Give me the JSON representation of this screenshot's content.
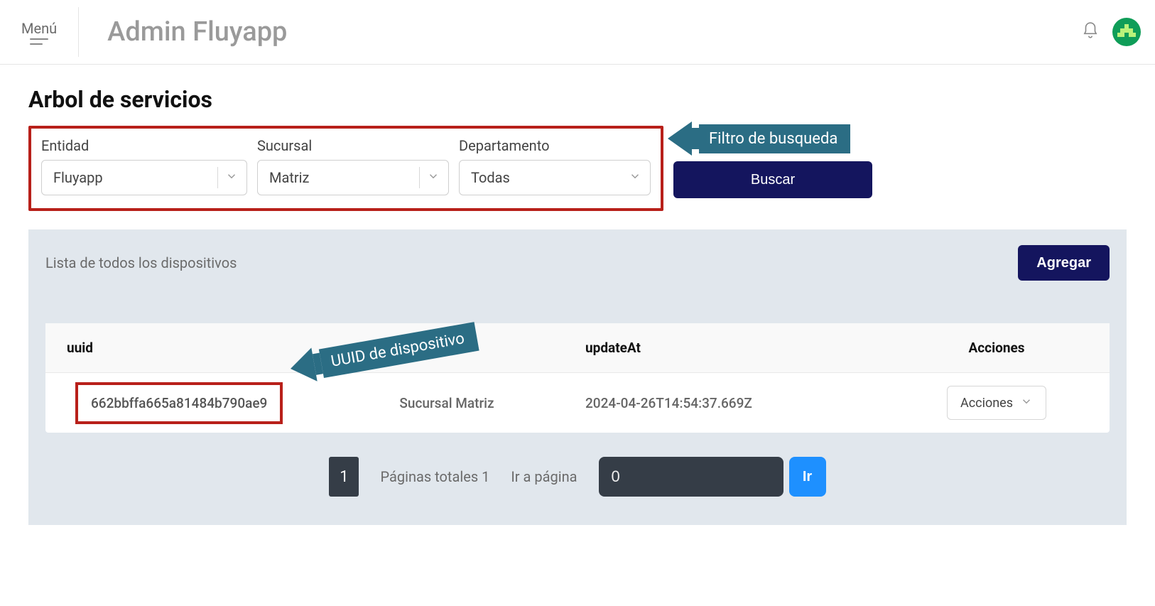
{
  "header": {
    "menu_label": "Menú",
    "app_title": "Admin Fluyapp"
  },
  "page": {
    "title": "Arbol de servicios"
  },
  "filters": {
    "entity": {
      "label": "Entidad",
      "value": "Fluyapp"
    },
    "branch": {
      "label": "Sucursal",
      "value": "Matriz"
    },
    "department": {
      "label": "Departamento",
      "value": "Todas"
    },
    "search_button": "Buscar"
  },
  "annotations": {
    "filter": "Filtro de busqueda",
    "uuid": "UUID de dispositivo"
  },
  "panel": {
    "list_title": "Lista de todos los dispositivos",
    "add_button": "Agregar"
  },
  "table": {
    "columns": {
      "uuid": "uuid",
      "name": "",
      "updateAt": "updateAt",
      "actions": "Acciones"
    },
    "rows": [
      {
        "uuid": "662bbffa665a81484b790ae9",
        "name": "Sucursal Matriz",
        "updateAt": "2024-04-26T14:54:37.669Z",
        "actions_label": "Acciones"
      }
    ]
  },
  "pagination": {
    "current": "1",
    "total_label": "Páginas totales 1",
    "goto_label": "Ir a página",
    "input_value": "0",
    "go_button": "Ir"
  }
}
